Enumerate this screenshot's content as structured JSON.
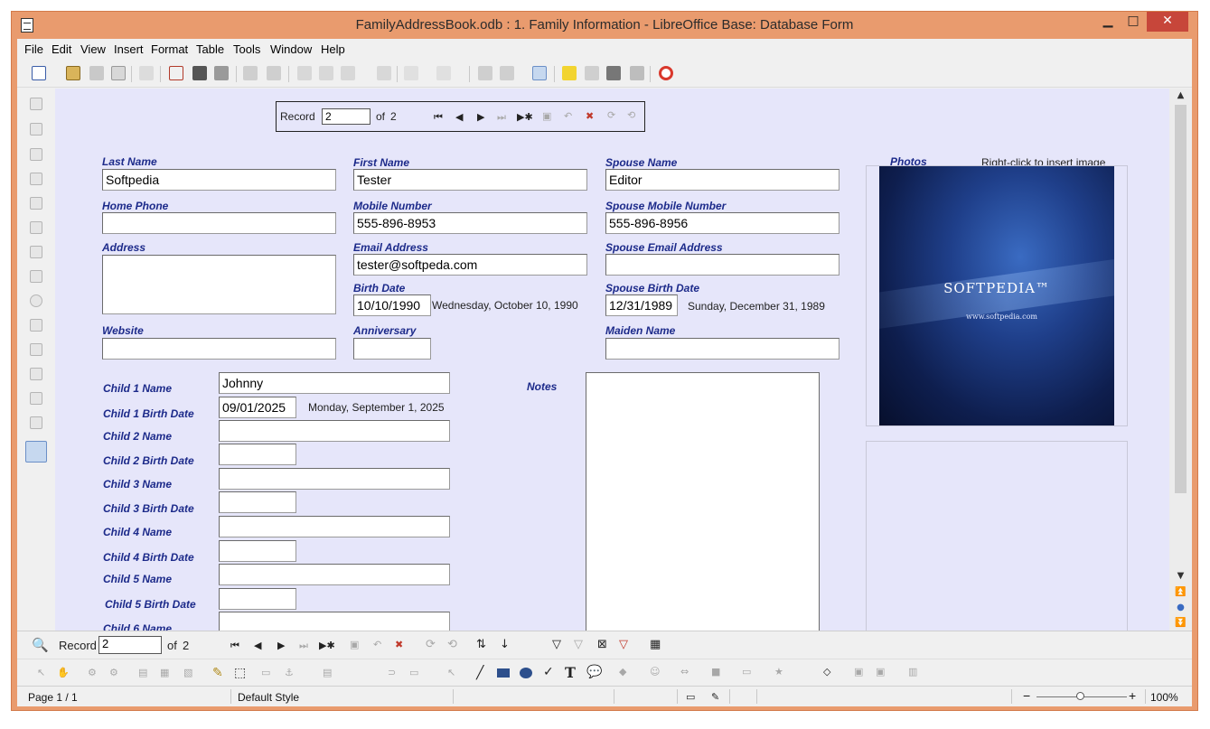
{
  "window": {
    "title": "FamilyAddressBook.odb : 1. Family Information - LibreOffice Base: Database Form",
    "minimize": "▁",
    "maximize": "□",
    "close": "✕"
  },
  "menu": [
    "File",
    "Edit",
    "View",
    "Insert",
    "Format",
    "Table",
    "Tools",
    "Window",
    "Help"
  ],
  "toolbar_icons": [
    "new-icon",
    "open-icon",
    "save-icon",
    "email-icon",
    "edit-icon",
    "pdf-icon",
    "print-icon",
    "preview-icon",
    "spellcheck-icon",
    "autospell-icon",
    "cut-icon",
    "copy-icon",
    "paste-icon",
    "clone-icon",
    "undo-icon",
    "redo-icon",
    "hyperlink-icon",
    "table-icon",
    "design-mode-icon",
    "wizard-icon",
    "form-navigator-icon",
    "stop-icon",
    "formatting-marks-icon",
    "help-icon"
  ],
  "record_nav": {
    "label": "Record",
    "value": "2",
    "of": "of",
    "total": "2"
  },
  "labels": {
    "last_name": "Last Name",
    "first_name": "First Name",
    "spouse_name": "Spouse Name",
    "photos": "Photos",
    "right_click": "Right-click to insert image",
    "home_phone": "Home Phone",
    "mobile_number": "Mobile Number",
    "spouse_mobile": "Spouse Mobile Number",
    "address": "Address",
    "email": "Email Address",
    "spouse_email": "Spouse Email Address",
    "birth_date": "Birth Date",
    "spouse_birth_date": "Spouse Birth Date",
    "website": "Website",
    "anniversary": "Anniversary",
    "maiden_name": "Maiden Name",
    "child1_name": "Child 1 Name",
    "child1_birth": "Child 1 Birth Date",
    "child2_name": "Child 2 Name",
    "child2_birth": "Child 2 Birth Date",
    "child3_name": "Child 3 Name",
    "child3_birth": "Child 3 Birth Date",
    "child4_name": "Child 4 Name",
    "child4_birth": "Child 4 Birth Date",
    "child5_name": "Child 5 Name",
    "child5_birth": "Child 5 Birth Date",
    "child6_name": "Child 6 Name",
    "notes": "Notes"
  },
  "values": {
    "last_name": "Softpedia",
    "first_name": "Tester",
    "spouse_name": "Editor",
    "home_phone": "",
    "mobile_number": "555-896-8953",
    "spouse_mobile": "555-896-8956",
    "address": "",
    "email": "tester@softpeda.com",
    "spouse_email": "",
    "birth_date": "10/10/1990",
    "birth_day": "Wednesday, October 10, 1990",
    "spouse_birth_date": "12/31/1989",
    "spouse_birth_day": "Sunday, December 31, 1989",
    "website": "",
    "anniversary": "",
    "maiden_name": "",
    "child1_name": "Johnny",
    "child1_birth": "09/01/2025",
    "child1_day": "Monday, September 1, 2025",
    "notes": ""
  },
  "photo": {
    "brand": "SOFTPEDIA™",
    "url": "www.softpedia.com"
  },
  "status": {
    "page": "Page 1 / 1",
    "style": "Default Style",
    "zoom": "100%",
    "zoom_minus": "−",
    "zoom_plus": "+"
  }
}
